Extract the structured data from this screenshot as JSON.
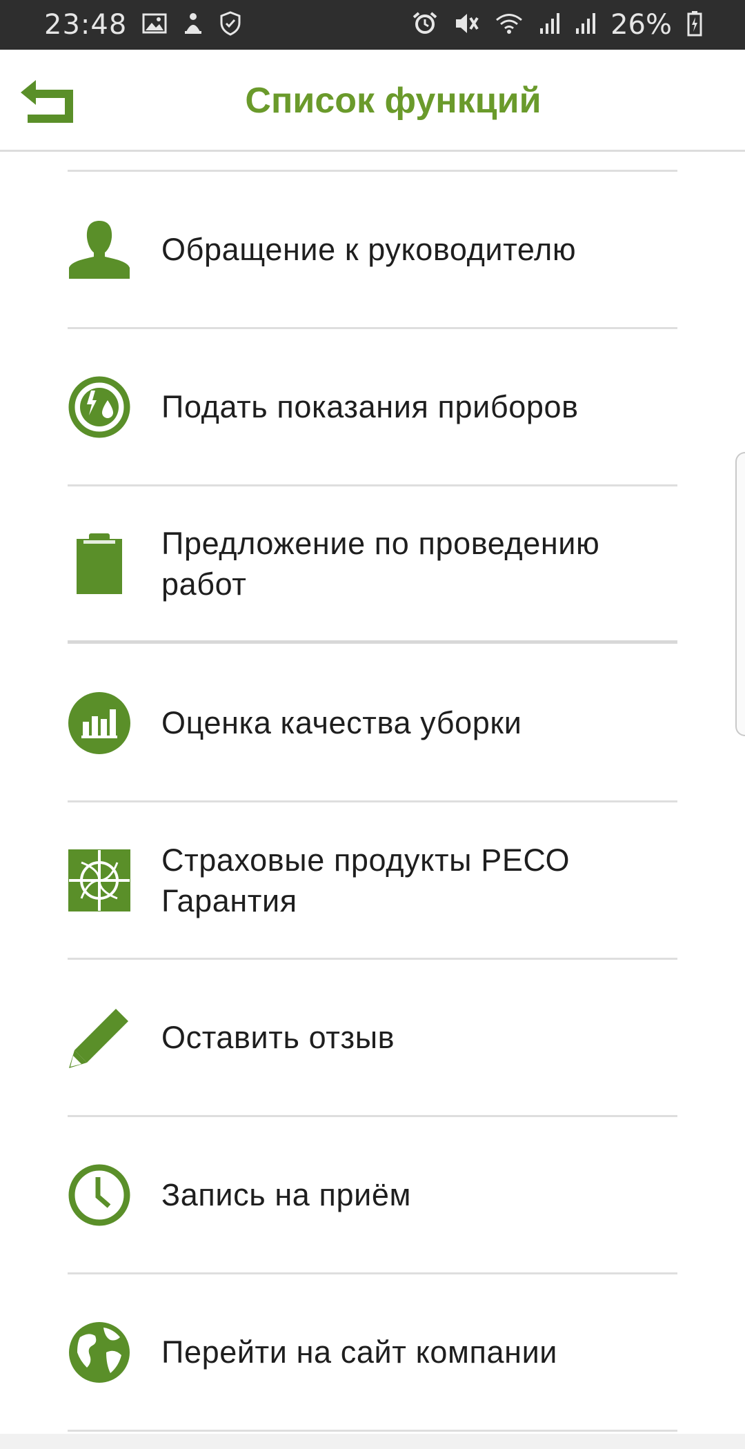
{
  "status_bar": {
    "time": "23:48",
    "battery": "26%",
    "left_icons": [
      "gallery-icon",
      "fan-notification-icon",
      "shield-check-icon"
    ],
    "right_icons": [
      "alarm-icon",
      "mute-icon",
      "wifi-icon",
      "signal-icon",
      "signal-icon",
      "battery-charging-icon"
    ]
  },
  "header": {
    "title": "Список функций",
    "back_icon": "back-arrow-icon"
  },
  "colors": {
    "accent": "#5a8f29",
    "title": "#6a9a2b",
    "divider": "#dedede",
    "text": "#1e1e1e",
    "status_bar": "#2e2e2e"
  },
  "items": [
    {
      "label": "Обращение к руководителю",
      "icon": "person-icon"
    },
    {
      "label": "Подать показания приборов",
      "icon": "meter-readings-icon"
    },
    {
      "label": "Предложение по проведению работ",
      "icon": "clipboard-icon"
    },
    {
      "label": "Оценка качества уборки",
      "icon": "bar-chart-icon"
    },
    {
      "label": "Страховые продукты РЕСО Гарантия",
      "icon": "reso-logo-icon"
    },
    {
      "label": "Оставить отзыв",
      "icon": "pencil-icon"
    },
    {
      "label": "Запись на приём",
      "icon": "clock-icon"
    },
    {
      "label": "Перейти на сайт компании",
      "icon": "globe-icon"
    }
  ]
}
